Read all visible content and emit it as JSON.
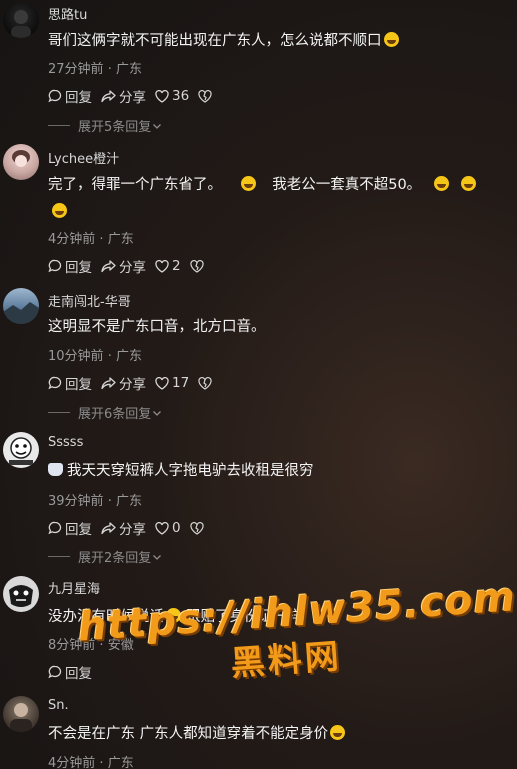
{
  "comments": [
    {
      "username": "思路tu",
      "text": "哥们这俩字就不可能出现在广东人，怎么说都不顺口",
      "time": "27分钟前",
      "location": "广东",
      "reply_label": "回复",
      "share_label": "分享",
      "likes": "36",
      "expand_label": "展开5条回复"
    },
    {
      "username": "Lychee橙汁",
      "text_line1": "完了，得罪一个广东省了。",
      "text_line1b": "我老公一套真不超50。",
      "time": "4分钟前",
      "location": "广东",
      "reply_label": "回复",
      "share_label": "分享",
      "likes": "2"
    },
    {
      "username": "走南闯北-华哥",
      "text": "这明显不是广东口音，北方口音。",
      "time": "10分钟前",
      "location": "广东",
      "reply_label": "回复",
      "share_label": "分享",
      "likes": "17",
      "expand_label": "展开6条回复"
    },
    {
      "username": "Sssss",
      "text": "我天天穿短裤人字拖电驴去收租是很穷",
      "time": "39分钟前",
      "location": "广东",
      "reply_label": "回复",
      "share_label": "分享",
      "likes": "0",
      "expand_label": "展开2条回复"
    },
    {
      "username": "九月星海",
      "text_a": "没办法有时候说话",
      "text_b": "跟贴了身份证一样",
      "time": "8分钟前",
      "location": "安徽",
      "reply_label": "回复"
    },
    {
      "username": "Sn.",
      "text": "不会是在广东  广东人都知道穿着不能定身价",
      "time": "4分钟前",
      "location": "广东"
    }
  ],
  "meta_separator": "·",
  "watermark": {
    "url": "https://ihlw35.com",
    "name": "黑料网"
  },
  "icons": {
    "reply": "comment-bubble-icon",
    "share": "share-arrow-icon",
    "like": "heart-icon",
    "dislike": "broken-heart-icon",
    "expand": "chevron-down-icon"
  }
}
